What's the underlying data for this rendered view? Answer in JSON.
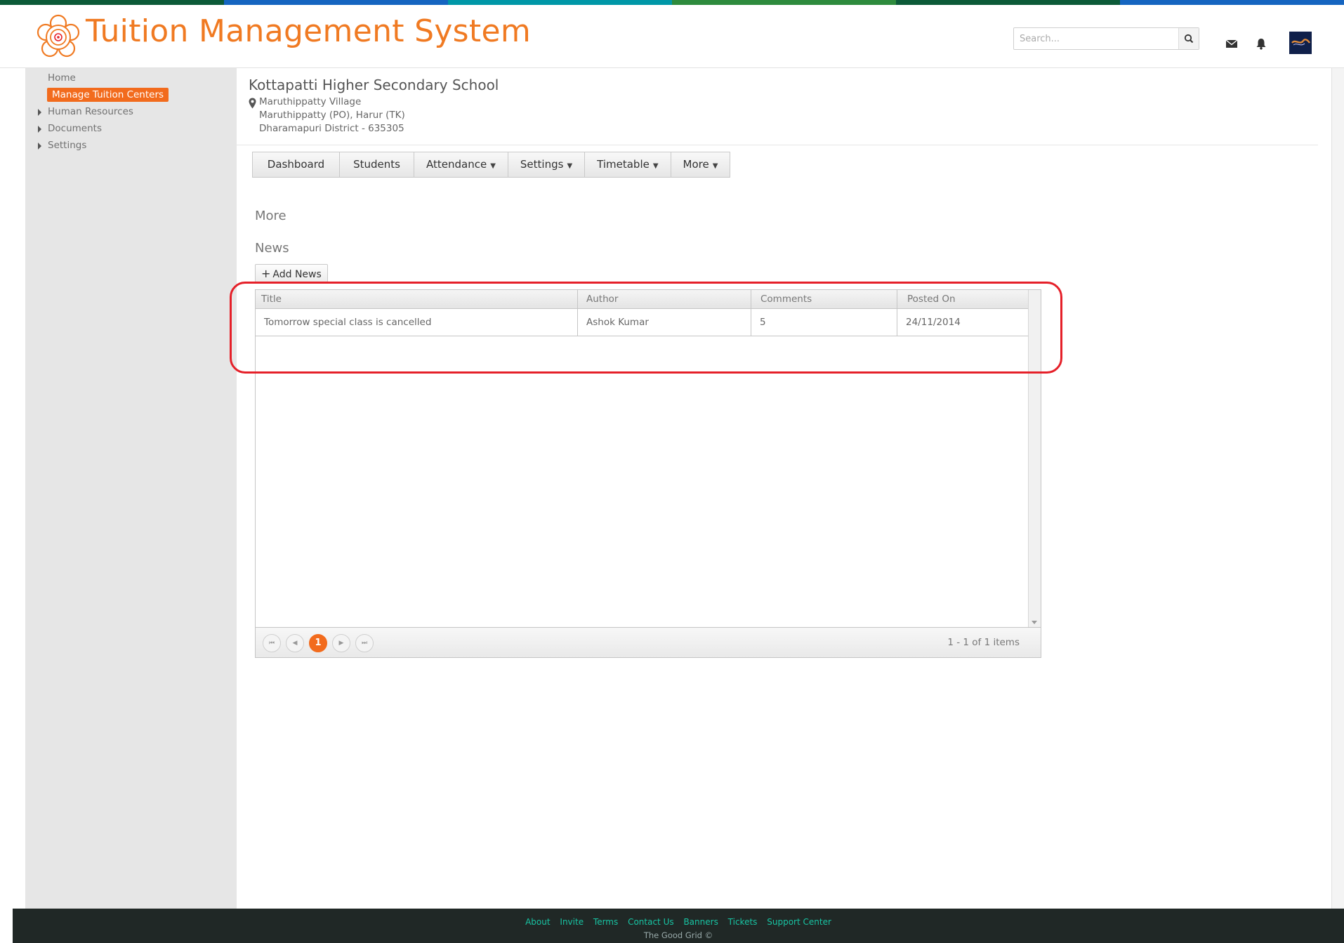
{
  "colors": {
    "accent_orange": "#f26b1d",
    "title_orange": "#f07a22",
    "footer_link": "#18c4a3",
    "footer_bg": "#202826",
    "highlight_red": "#e52029",
    "top_stripe": [
      "#0c5a38",
      "#1565c0",
      "#0097a7",
      "#2e8b3d",
      "#0c5a38",
      "#1565c0"
    ]
  },
  "header": {
    "app_title": "Tuition Management System",
    "search_placeholder": "Search...",
    "icons": [
      "search-icon",
      "mail-icon",
      "bell-icon",
      "avatar"
    ]
  },
  "sidebar": {
    "items": [
      {
        "label": "Home",
        "active": false,
        "expandable": false
      },
      {
        "label": "Manage Tuition  Centers",
        "active": true,
        "expandable": false
      },
      {
        "label": "Human Resources",
        "active": false,
        "expandable": true
      },
      {
        "label": "Documents",
        "active": false,
        "expandable": true
      },
      {
        "label": "Settings",
        "active": false,
        "expandable": true
      }
    ]
  },
  "center": {
    "name": "Kottapatti Higher Secondary School",
    "address": [
      "Maruthippatty Village",
      "Maruthippatty (PO), Harur (TK)",
      "Dharamapuri District - 635305"
    ]
  },
  "tabs": [
    {
      "label": "Dashboard",
      "dropdown": false
    },
    {
      "label": "Students",
      "dropdown": false
    },
    {
      "label": "Attendance",
      "dropdown": true
    },
    {
      "label": "Settings",
      "dropdown": true
    },
    {
      "label": "Timetable",
      "dropdown": true
    },
    {
      "label": "More",
      "dropdown": true
    }
  ],
  "section": {
    "title": "More",
    "subtitle": "News",
    "add_button": "Add News"
  },
  "grid": {
    "columns": [
      "Title",
      "Author",
      "Comments",
      "Posted On"
    ],
    "rows": [
      [
        "Tomorrow special class is cancelled",
        "Ashok Kumar",
        "5",
        "24/11/2014"
      ]
    ],
    "pager": {
      "current_page": "1",
      "info": "1 - 1 of 1 items"
    }
  },
  "footer": {
    "links": [
      "About",
      "Invite",
      "Terms",
      "Contact Us",
      "Banners",
      "Tickets",
      "Support Center"
    ],
    "copyright": "The Good Grid ©"
  }
}
